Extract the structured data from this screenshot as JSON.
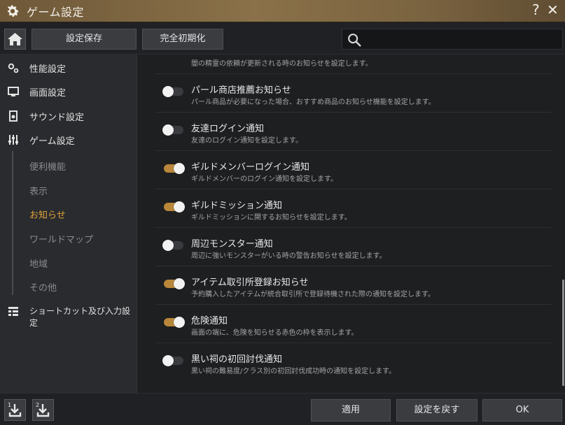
{
  "window": {
    "title": "ゲーム設定",
    "help_glyph": "?",
    "close_glyph": "✕"
  },
  "toolbar": {
    "save_label": "設定保存",
    "reset_label": "完全初期化"
  },
  "sidebar": {
    "items": [
      {
        "label": "性能設定",
        "icon": "performance-gears-icon"
      },
      {
        "label": "画面設定",
        "icon": "monitor-icon"
      },
      {
        "label": "サウンド設定",
        "icon": "speaker-icon"
      },
      {
        "label": "ゲーム設定",
        "icon": "sliders-icon"
      }
    ],
    "subitems": [
      {
        "label": "便利機能",
        "active": false
      },
      {
        "label": "表示",
        "active": false
      },
      {
        "label": "お知らせ",
        "active": true
      },
      {
        "label": "ワールドマップ",
        "active": false
      },
      {
        "label": "地域",
        "active": false
      },
      {
        "label": "その他",
        "active": false
      }
    ],
    "shortcut": {
      "label": "ショートカット及び入力設定",
      "icon": "keyboard-list-icon"
    }
  },
  "content": {
    "partial_top_desc": "闇の精霊の依頼が更新される時のお知らせを設定します。",
    "settings": [
      {
        "title": "パール商店推薦お知らせ",
        "desc": "パール商品が必要になった場合、おすすめ商品のお知らせ機能を設定します。",
        "on": false
      },
      {
        "title": "友達ログイン通知",
        "desc": "友達のログイン通知を設定します。",
        "on": false
      },
      {
        "title": "ギルドメンバーログイン通知",
        "desc": "ギルドメンバーのログイン通知を設定します。",
        "on": true
      },
      {
        "title": "ギルドミッション通知",
        "desc": "ギルドミッションに関するお知らせを設定します。",
        "on": true
      },
      {
        "title": "周辺モンスター通知",
        "desc": "周辺に強いモンスターがいる時の警告お知らせを設定します。",
        "on": false
      },
      {
        "title": "アイテム取引所登録お知らせ",
        "desc": "予約購入したアイテムが統合取引所で登録待機された際の通知を設定します。",
        "on": true
      },
      {
        "title": "危険通知",
        "desc": "画面の端に、危険を知らせる赤色の枠を表示します。",
        "on": true
      },
      {
        "title": "黒い祠の初回討伐通知",
        "desc": "黒い祠の難易度/クラス別の初回討伐成功時の通知を設定します。",
        "on": false
      }
    ]
  },
  "footer": {
    "apply_label": "適用",
    "revert_label": "設定を戻す",
    "ok_label": "OK",
    "icon_buttons": [
      {
        "icon": "import-1-icon",
        "badge": "1"
      },
      {
        "icon": "import-2-icon",
        "badge": "2"
      }
    ]
  },
  "colors": {
    "accent": "#e0a43c",
    "toggle_on": "#b8873a",
    "title_bar": "#7a6340"
  }
}
